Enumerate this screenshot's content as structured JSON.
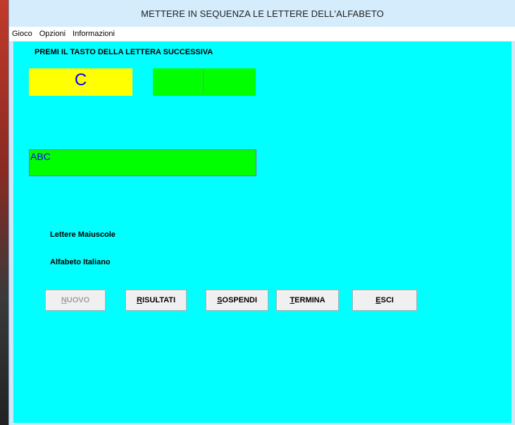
{
  "window": {
    "title": "METTERE IN SEQUENZA LE LETTERE DELL'ALFABETO"
  },
  "menu": {
    "items": [
      "Gioco",
      "Opzioni",
      "Informazioni"
    ]
  },
  "game": {
    "prompt": "PREMI IL TASTO DELLA LETTERA SUCCESSIVA",
    "current_letter": "C",
    "input_value": "",
    "sequence": "ABC",
    "case_mode": "Lettere Maiuscole",
    "alphabet": "Alfabeto Italiano"
  },
  "buttons": {
    "nuovo": {
      "first": "N",
      "rest": "UOVO"
    },
    "risultati": {
      "first": "R",
      "rest": "ISULTATI"
    },
    "sospendi": {
      "first": "S",
      "rest": "OSPENDI"
    },
    "termina": {
      "first": "T",
      "rest": "ERMINA"
    },
    "esci": {
      "first": "E",
      "rest": "SCI"
    }
  },
  "colors": {
    "client_bg": "#00ffff",
    "letter_box": "#ffff00",
    "input_box": "#00ff00",
    "sequence_box": "#00ff00",
    "letter_text": "#0000ff"
  }
}
